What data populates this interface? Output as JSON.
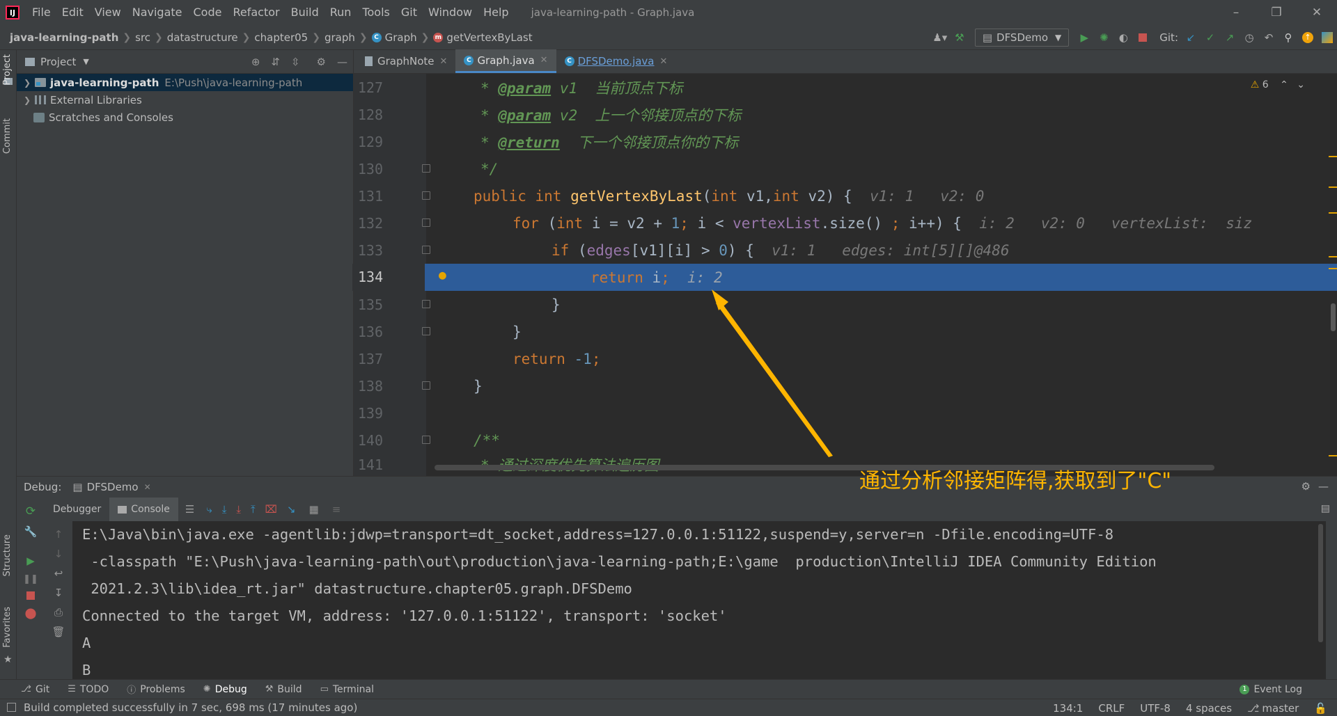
{
  "menu": {
    "items": [
      "File",
      "Edit",
      "View",
      "Navigate",
      "Code",
      "Refactor",
      "Build",
      "Run",
      "Tools",
      "Git",
      "Window",
      "Help"
    ],
    "window_title": "java-learning-path - Graph.java"
  },
  "breadcrumb": {
    "items": [
      "java-learning-path",
      "src",
      "datastructure",
      "chapter05",
      "graph",
      "Graph",
      "getVertexByLast"
    ]
  },
  "toolbar": {
    "run_config": "DFSDemo",
    "git_label": "Git:"
  },
  "left_stripe": {
    "project": "Project",
    "commit": "Commit",
    "structure": "Structure",
    "favorites": "Favorites"
  },
  "project": {
    "title": "Project",
    "root": "java-learning-path",
    "root_path": "E:\\Push\\java-learning-path",
    "external_libraries": "External Libraries",
    "scratches": "Scratches and Consoles"
  },
  "editor": {
    "tabs": [
      {
        "label": "GraphNote"
      },
      {
        "label": "Graph.java"
      },
      {
        "label": "DFSDemo.java"
      }
    ],
    "warnings": "6",
    "lines": [
      "127",
      "128",
      "129",
      "130",
      "131",
      "132",
      "133",
      "134",
      "135",
      "136",
      "137",
      "138",
      "139",
      "140",
      "141"
    ]
  },
  "code": {
    "l127_tag": "@param",
    "l127_var": " v1",
    "l127_text": "  当前顶点下标",
    "l128_tag": "@param",
    "l128_var": " v2",
    "l128_text": "  上一个邻接顶点的下标",
    "l129_tag": "@return",
    "l129_text": "  下一个邻接顶点你的下标",
    "l130": "*/",
    "l131_a": "public int ",
    "l131_fn": "getVertexByLast",
    "l131_b": "(",
    "l131_c": "int ",
    "l131_d": "v1,",
    "l131_e": "int ",
    "l131_f": "v2) {  ",
    "l131_hint": "v1: 1   v2: 0",
    "l132_a": "for ",
    "l132_b": "(",
    "l132_c": "int ",
    "l132_d": "i = v2 + ",
    "l132_e": "1",
    "l132_f": "; ",
    "l132_g": "i < ",
    "l132_h": "vertexList",
    "l132_i": ".size() ",
    "l132_j": "; ",
    "l132_k": "i++) {  ",
    "l132_hint": "i: 2   v2: 0   vertexList:  siz",
    "l133_a": "if ",
    "l133_b": "(",
    "l133_c": "edges",
    "l133_d": "[v1][i] > ",
    "l133_e": "0",
    "l133_f": ") {  ",
    "l133_hint": "v1: 1   edges: int[5][]@486",
    "l134_a": "return ",
    "l134_b": "i",
    "l134_c": ";  ",
    "l134_hint": "i: 2",
    "l135": "}",
    "l136": "}",
    "l137_a": "return ",
    "l137_b": "-1",
    "l137_c": ";",
    "l138": "}",
    "l139": "",
    "l140": "/**",
    "l141": "* 通过深度优先算法遍历图"
  },
  "annotation": {
    "text": "通过分析邻接矩阵得,获取到了\"C\""
  },
  "debug": {
    "label": "Debug:",
    "session": "DFSDemo",
    "tab_debugger": "Debugger",
    "tab_console": "Console",
    "console_lines": [
      "E:\\Java\\bin\\java.exe -agentlib:jdwp=transport=dt_socket,address=127.0.0.1:51122,suspend=y,server=n -Dfile.encoding=UTF-8",
      " -classpath \"E:\\Push\\java-learning-path\\out\\production\\java-learning-path;E:\\game  production\\IntelliJ IDEA Community Edition",
      " 2021.2.3\\lib\\idea_rt.jar\" datastructure.chapter05.graph.DFSDemo",
      "Connected to the target VM, address: '127.0.0.1:51122', transport: 'socket'",
      "A",
      "B"
    ]
  },
  "bottom_tabs": [
    "Git",
    "TODO",
    "Problems",
    "Debug",
    "Build",
    "Terminal"
  ],
  "event_log": "Event Log",
  "status": {
    "message": "Build completed successfully in 7 sec, 698 ms (17 minutes ago)",
    "position": "134:1",
    "line_sep": "CRLF",
    "encoding": "UTF-8",
    "indent": "4 spaces",
    "branch": "master"
  }
}
